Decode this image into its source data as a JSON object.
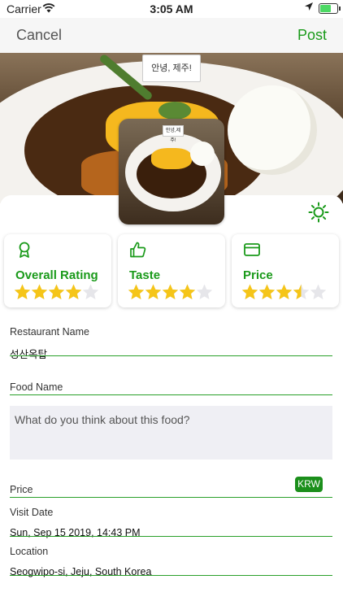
{
  "status_bar": {
    "carrier": "Carrier",
    "time": "3:05 AM"
  },
  "nav": {
    "cancel_label": "Cancel",
    "post_label": "Post"
  },
  "hero": {
    "sign_text": "안녕, 제주!"
  },
  "thumbnail": {
    "sign_text": "안녕,제주!"
  },
  "ratings": [
    {
      "label": "Overall Rating",
      "icon": "award-ribbon-icon",
      "stars": 4.0,
      "max": 5
    },
    {
      "label": "Taste",
      "icon": "thumbs-up-icon",
      "stars": 4.0,
      "max": 5
    },
    {
      "label": "Price",
      "icon": "credit-card-icon",
      "stars": 3.5,
      "max": 5
    }
  ],
  "form": {
    "restaurant_label": "Restaurant Name",
    "restaurant_value": "성산옥탑",
    "food_label": "Food Name",
    "food_value": "",
    "comment_placeholder": "What do you think about this food?",
    "price_label": "Price",
    "currency": "KRW",
    "visit_date_label": "Visit Date",
    "visit_date_value": "Sun, Sep 15 2019, 14:43 PM",
    "location_label": "Location",
    "location_value": "Seogwipo-si, Jeju, South Korea"
  },
  "colors": {
    "accent": "#1a9a1a",
    "star": "#f5c518",
    "star_empty": "#e6e6ea"
  }
}
